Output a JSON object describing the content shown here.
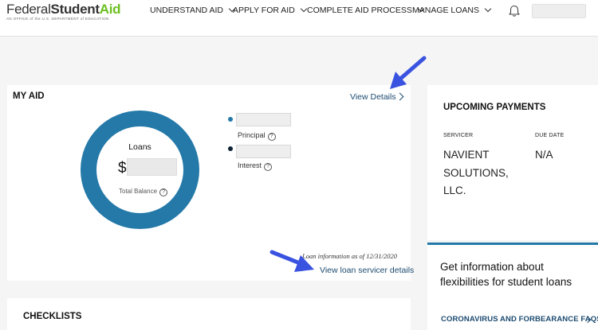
{
  "header": {
    "logo": {
      "word1": "Federal",
      "word2": "Student",
      "word3": "Aid",
      "tagline": "AN OFFICE of the U.S. DEPARTMENT of EDUCATION"
    },
    "nav": [
      {
        "label": "UNDERSTAND AID"
      },
      {
        "label": "APPLY FOR AID"
      },
      {
        "label": "COMPLETE AID PROCESS"
      },
      {
        "label": "MANAGE LOANS"
      }
    ],
    "icons": {
      "notifications": "bell-icon"
    }
  },
  "my_aid": {
    "title": "MY AID",
    "view_details": "View Details",
    "donut": {
      "label": "Loans",
      "currency": "$",
      "sub_label": "Total Balance",
      "color": "#2479a8"
    },
    "legend": [
      {
        "label": "Principal",
        "color": "#2479a8"
      },
      {
        "label": "Interest",
        "color": "#0d2233"
      }
    ],
    "help_glyph": "?",
    "loan_info": "Loan information as of 12/31/2020",
    "servicer_link": "View loan servicer details"
  },
  "checklists": {
    "title": "CHECKLISTS"
  },
  "upcoming": {
    "title": "UPCOMING PAYMENTS",
    "col_servicer": "SERVICER",
    "col_due": "DUE DATE",
    "servicer": "NAVIENT SOLUTIONS, LLC.",
    "due": "N/A"
  },
  "covid": {
    "text": "Get information about flexibilities for student loans",
    "link": "CORONAVIRUS AND FORBEARANCE FAQS"
  },
  "colors": {
    "accent": "#2479a8",
    "link": "#1b4a70",
    "annotation_arrow": "#3a52e0",
    "logo_green": "#6abf1e"
  }
}
